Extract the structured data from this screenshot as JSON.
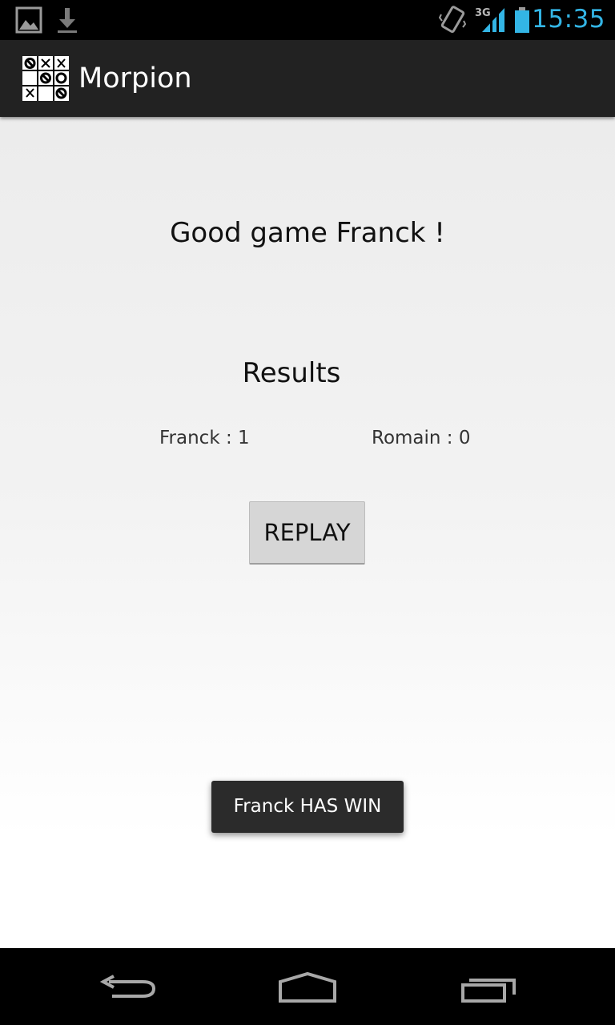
{
  "status_bar": {
    "time": "15:35",
    "network_type": "3G",
    "icons": [
      "picture-icon",
      "download-icon",
      "vibrate-icon",
      "signal-icon",
      "battery-icon"
    ],
    "clock_color": "#33b5e5"
  },
  "action_bar": {
    "title": "Morpion",
    "icon": "tic-tac-toe-icon"
  },
  "main": {
    "greeting": "Good game Franck !",
    "results_heading": "Results",
    "scores": [
      {
        "label": "Franck : 1"
      },
      {
        "label": "Romain : 0"
      }
    ],
    "replay_label": "REPLAY"
  },
  "toast": {
    "message": "Franck HAS WIN"
  },
  "nav_bar": {
    "buttons": [
      "back-icon",
      "home-icon",
      "recent-apps-icon"
    ]
  }
}
